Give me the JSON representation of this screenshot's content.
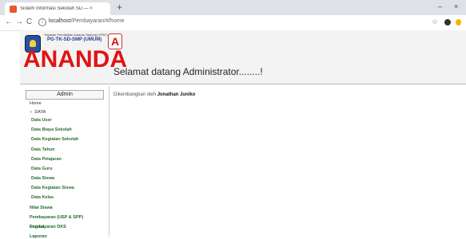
{
  "browser": {
    "tab_title": "Sistem Informasi Sekolah SD — ×",
    "new_tab": "+",
    "url_host": "localhost",
    "url_path": "/Pembayaran/#/home",
    "minimize": "–",
    "close": "×",
    "back": "←",
    "forward": "→",
    "reload": "C",
    "info": "i",
    "star": "☆"
  },
  "header": {
    "logo_line1": "Yayasan Pendidikan Ananda Tanjung (YPAT)",
    "logo_line2": "PG-TK-SD-SMP (UMUM)",
    "logo_badge": "A",
    "logo_main": "ANANDA"
  },
  "sidebar": {
    "admin_label": "Admin",
    "home": "Home",
    "data": "DATA",
    "items": [
      "Data User",
      "Data Biaya Sekolah",
      "Data Kegiatan Sekolah",
      "Data Tahun",
      "Data Pelajaran",
      "Data Guru",
      "Data Siswa",
      "Data Kegiatan Siswa",
      "Data Kelas"
    ],
    "nilai_siswa": "Nilai Siswa",
    "pembayaran_usp": "Pembayaran (USP & SPP)",
    "pembayaran_dks": "Pembayaran DKS",
    "laporan": "Laporan",
    "logout": "Logout"
  },
  "main": {
    "welcome": "Selamat datang Administrator........!",
    "dev_prefix": "Dikembangkan oleh",
    "dev_name": "Jonathan Juniko"
  }
}
